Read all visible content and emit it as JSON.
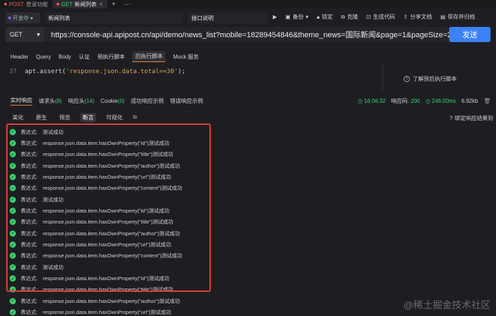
{
  "tabs": [
    {
      "method": "POST",
      "label": "登录功能",
      "active": false
    },
    {
      "method": "GET",
      "label": "新闻列表",
      "active": true
    }
  ],
  "tabbar_plus": "+",
  "tabbar_more": "···",
  "toolbar": {
    "env": "开发中",
    "request_name": "新闻列表",
    "interface_link": "接口说明",
    "actions": {
      "run": "",
      "backup": "备份",
      "lock": "锁定",
      "clone": "克隆",
      "gen_code": "生成代码",
      "share": "分享文档",
      "save": "保存并归档"
    }
  },
  "urlbar": {
    "method": "GET",
    "url": "https://console-api.apipost.cn/api/demo/news_list?mobile=18289454846&theme_news=国际新闻&page=1&pageSize=20",
    "send": "发送"
  },
  "request_tabs": [
    "Header",
    "Query",
    "Body",
    "认证",
    "预执行脚本",
    "后执行脚本",
    "Mock 服务"
  ],
  "request_tab_active": "后执行脚本",
  "code": {
    "line_no": "37",
    "prefix": "apt.assert(",
    "string": "'response.json.data.total==30'",
    "suffix": ");"
  },
  "hint": "了解预后执行脚本",
  "response_tabs": {
    "realtime": "实时响应",
    "req_header": "请求头",
    "req_header_count": "(8)",
    "resp_header": "响应头",
    "resp_header_count": "(14)",
    "cookie": "Cookie",
    "cookie_count": "(0)",
    "success_example": "成功响应示例",
    "error_example": "错误响应示例"
  },
  "response_meta": {
    "time": "16:06:32",
    "status_label": "响应码:",
    "status": "200",
    "duration": "248.00ms",
    "size": "6.92kb"
  },
  "sub_tabs": [
    "美化",
    "原生",
    "预览",
    "断言",
    "可视化"
  ],
  "sub_tab_active": "断言",
  "bind_text": "绑定响应结果到",
  "assertions": [
    {
      "label": "表达式:",
      "text": "测试成功"
    },
    {
      "label": "表达式:",
      "text": "response.json.data.item.hasOwnProperty(\"id\")测试成功"
    },
    {
      "label": "表达式:",
      "text": "response.json.data.item.hasOwnProperty(\"title\")测试成功"
    },
    {
      "label": "表达式:",
      "text": "response.json.data.item.hasOwnProperty(\"author\")测试成功"
    },
    {
      "label": "表达式:",
      "text": "response.json.data.item.hasOwnProperty(\"url\")测试成功"
    },
    {
      "label": "表达式:",
      "text": "response.json.data.item.hasOwnProperty(\"content\")测试成功"
    },
    {
      "label": "表达式:",
      "text": "测试成功"
    },
    {
      "label": "表达式:",
      "text": "response.json.data.item.hasOwnProperty(\"id\")测试成功"
    },
    {
      "label": "表达式:",
      "text": "response.json.data.item.hasOwnProperty(\"title\")测试成功"
    },
    {
      "label": "表达式:",
      "text": "response.json.data.item.hasOwnProperty(\"author\")测试成功"
    },
    {
      "label": "表达式:",
      "text": "response.json.data.item.hasOwnProperty(\"url\")测试成功"
    },
    {
      "label": "表达式:",
      "text": "response.json.data.item.hasOwnProperty(\"content\")测试成功"
    },
    {
      "label": "表达式:",
      "text": "测试成功"
    },
    {
      "label": "表达式:",
      "text": "response.json.data.item.hasOwnProperty(\"id\")测试成功"
    },
    {
      "label": "表达式:",
      "text": "response.json.data.item.hasOwnProperty(\"title\")测试成功"
    },
    {
      "label": "表达式:",
      "text": "response.json.data.item.hasOwnProperty(\"author\")测试成功"
    },
    {
      "label": "表达式:",
      "text": "response.json.data.item.hasOwnProperty(\"url\")测试成功"
    }
  ],
  "watermark": "@稀土掘金技术社区",
  "colors": {
    "accent_orange": "#e88a3a",
    "success_green": "#3ccf6c",
    "send_blue": "#3b82f6",
    "highlight_red": "#e0403a"
  }
}
